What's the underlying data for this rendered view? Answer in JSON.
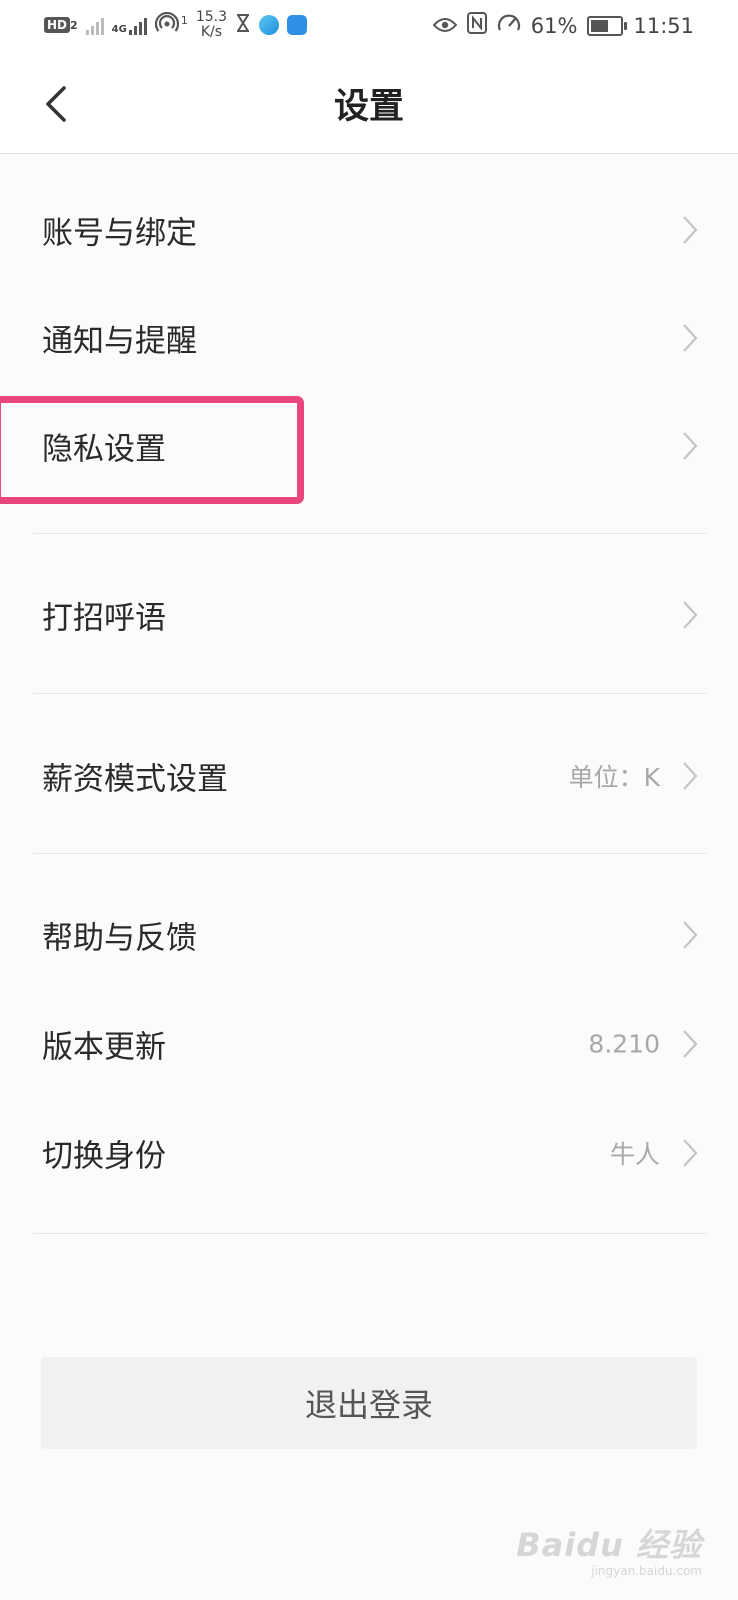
{
  "status_bar": {
    "hd_badge": "HD",
    "hd_sim": "2",
    "net_type": "4G",
    "hotspot_count": "1",
    "speed_value": "15.3",
    "speed_unit": "K/s",
    "battery_percent_text": "61%",
    "battery_level": 0.61,
    "time": "11:51",
    "icons": [
      "hd-icon",
      "signal-icon",
      "signal-4g-icon",
      "hotspot-icon",
      "hourglass-icon",
      "app-icon",
      "location-app-icon",
      "eye-icon",
      "nfc-icon",
      "speedometer-icon",
      "battery-icon"
    ]
  },
  "header": {
    "title": "设置",
    "back_icon": "chevron-left-icon"
  },
  "settings": {
    "items": [
      {
        "label": "账号与绑定",
        "value": ""
      },
      {
        "label": "通知与提醒",
        "value": ""
      },
      {
        "label": "隐私设置",
        "value": ""
      },
      {
        "label": "打招呼语",
        "value": ""
      },
      {
        "label": "薪资模式设置",
        "value": "单位：K"
      },
      {
        "label": "帮助与反馈",
        "value": ""
      },
      {
        "label": "版本更新",
        "value": "8.210"
      },
      {
        "label": "切换身份",
        "value": "牛人"
      }
    ]
  },
  "logout": {
    "label": "退出登录"
  },
  "watermark": {
    "main": "Baidu 经验",
    "sub": "jingyan.baidu.com"
  },
  "colors": {
    "highlight": "#e8467c",
    "background": "#fbfbfb",
    "value_text": "#a8a8a8"
  }
}
